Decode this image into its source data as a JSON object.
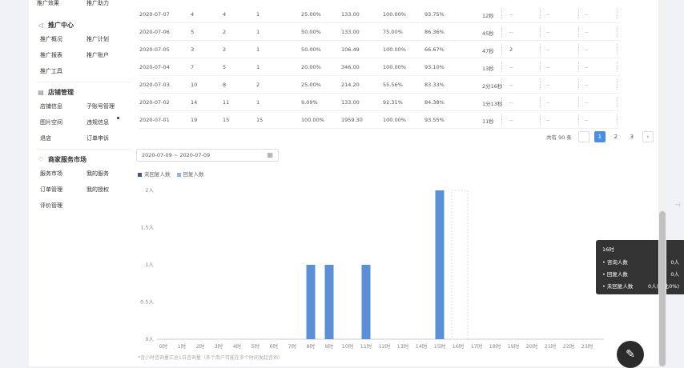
{
  "sidebar": {
    "top_items": [
      "推广效果",
      "推广助力"
    ],
    "sections": [
      {
        "title": "推广中心",
        "icon": "megaphone-icon",
        "items": [
          "推广概况",
          "推广计划",
          "推广报表",
          "推广账户",
          "推广工具"
        ]
      },
      {
        "title": "店铺管理",
        "icon": "store-icon",
        "items": [
          "店铺信息",
          "子账号管理",
          "图片空间",
          "违规信息",
          "退店",
          "订单申诉"
        ]
      },
      {
        "title": "商家服务市场",
        "icon": "heart-icon",
        "items": [
          "服务市场",
          "我的服务",
          "订单管理",
          "我的授权",
          "评价管理"
        ]
      }
    ]
  },
  "table": {
    "rows": [
      [
        "2020-07-07",
        "4",
        "4",
        "1",
        "25.00%",
        "133.00",
        "100.00%",
        "93.75%",
        "12秒",
        "--",
        "--",
        "--"
      ],
      [
        "2020-07-06",
        "5",
        "2",
        "1",
        "50.00%",
        "133.00",
        "75.00%",
        "86.36%",
        "45秒",
        "--",
        "--",
        "--"
      ],
      [
        "2020-07-05",
        "3",
        "2",
        "1",
        "50.00%",
        "106.49",
        "100.00%",
        "66.67%",
        "47秒",
        "2",
        "--",
        "--"
      ],
      [
        "2020-07-04",
        "7",
        "5",
        "1",
        "20.00%",
        "346.00",
        "100.00%",
        "93.10%",
        "13秒",
        "--",
        "--",
        "--"
      ],
      [
        "2020-07-03",
        "10",
        "8",
        "2",
        "25.00%",
        "214.20",
        "55.56%",
        "83.33%",
        "2分16秒",
        "--",
        "--",
        "--"
      ],
      [
        "2020-07-02",
        "14",
        "11",
        "1",
        "9.09%",
        "133.00",
        "92.31%",
        "84.38%",
        "1分13秒",
        "--",
        "--",
        "--"
      ],
      [
        "2020-07-01",
        "19",
        "15",
        "15",
        "100.00%",
        "1959.30",
        "100.00%",
        "93.55%",
        "11秒",
        "--",
        "--",
        "--"
      ]
    ]
  },
  "pagination": {
    "total": "共有 90 条",
    "pages": [
      "1",
      "2",
      "3"
    ],
    "current": "1",
    "prev_icon": "chevron-left-icon",
    "next_icon": "chevron-right-icon"
  },
  "date_range": {
    "value": "2020-07-09 ~ 2020-07-09",
    "icon": "calendar-icon"
  },
  "legend": {
    "unreplied": "未回复人数",
    "replied": "回复人数"
  },
  "colors": {
    "bar": "#5b8fd6",
    "unreplied": "#3d5a80",
    "replied": "#8fb3e8",
    "accent": "#4a90e2"
  },
  "chart_data": {
    "type": "bar",
    "categories": [
      "0时",
      "1时",
      "2时",
      "3时",
      "4时",
      "5时",
      "6时",
      "7时",
      "8时",
      "9时",
      "10时",
      "11时",
      "12时",
      "13时",
      "14时",
      "15时",
      "16时",
      "17时",
      "18时",
      "19时",
      "20时",
      "21时",
      "22时",
      "23时"
    ],
    "series": [
      {
        "name": "回复人数",
        "values": [
          0,
          0,
          0,
          0,
          0,
          0,
          0,
          0,
          1,
          1,
          0,
          1,
          0,
          0,
          0,
          2,
          0,
          0,
          0,
          0,
          0,
          0,
          0,
          0
        ]
      }
    ],
    "yticks": [
      "0人",
      "0.5人",
      "1人",
      "1.5人",
      "2人"
    ],
    "ylim": [
      0,
      2
    ],
    "grid": false,
    "legend": "top-left"
  },
  "tooltip": {
    "title": "16时",
    "rows": [
      {
        "label": "咨询人数",
        "value": "0人"
      },
      {
        "label": "回复人数",
        "value": "0人"
      },
      {
        "label": "未回复人数",
        "value": "0人(占比0%)"
      }
    ]
  },
  "footnote": "*咨小时咨询量汇总1日咨询量（多个用户可能在多个时间发起咨询）",
  "fab_icon": "edit-icon"
}
